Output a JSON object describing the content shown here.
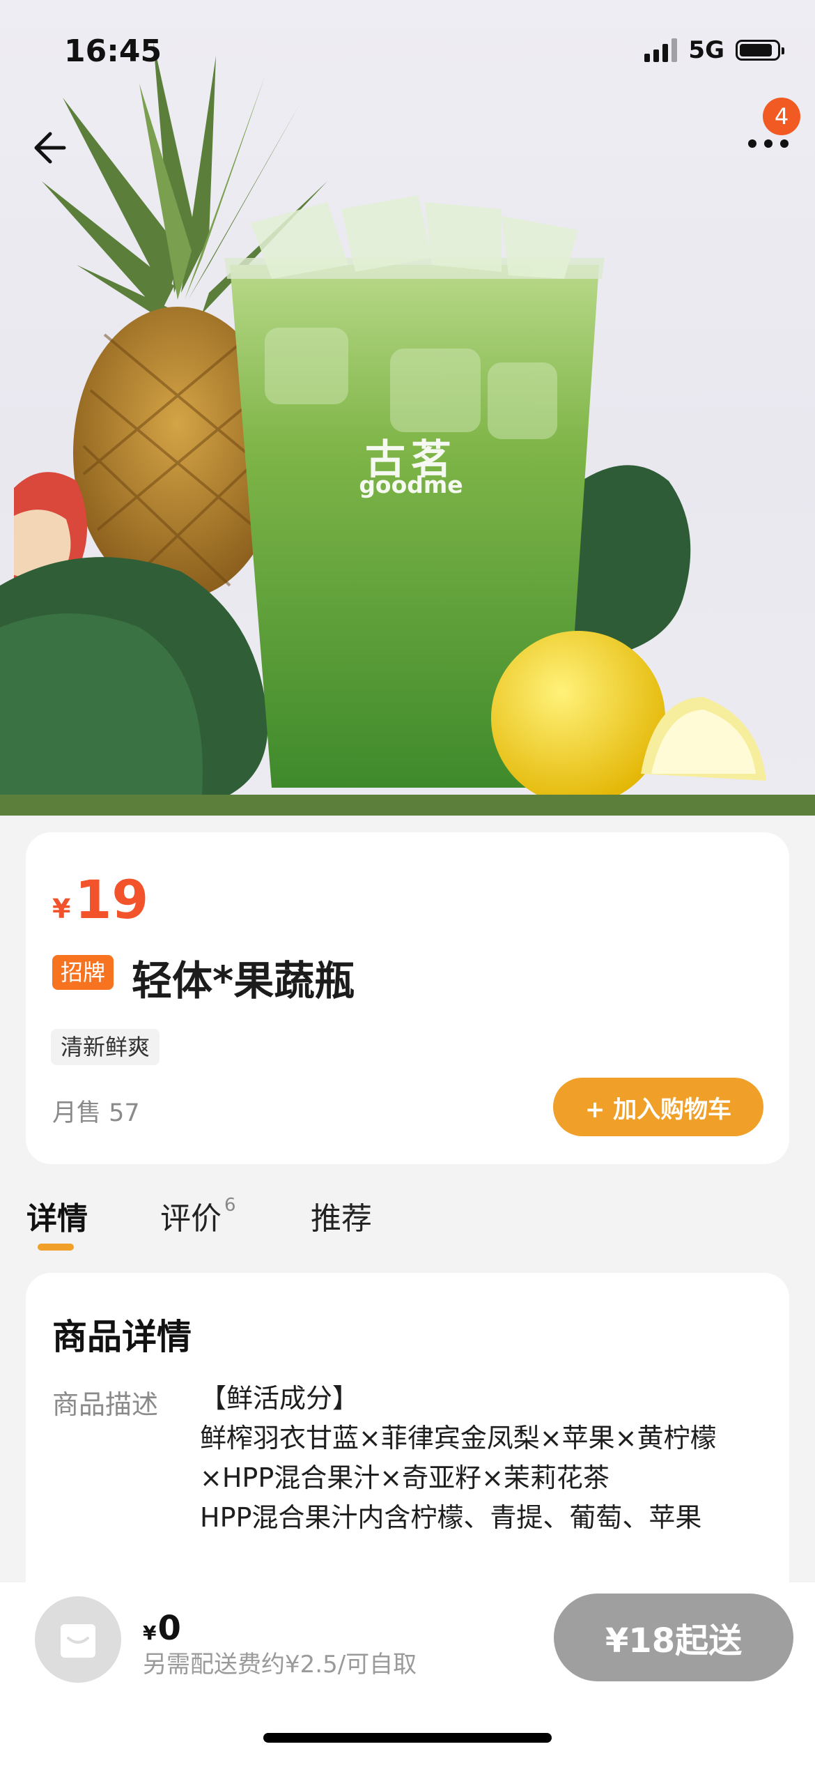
{
  "status_bar": {
    "time": "16:45",
    "network": "5G"
  },
  "nav": {
    "badge_count": "4"
  },
  "hero": {
    "cup_logo_cn": "古茗",
    "cup_logo_en": "goodme"
  },
  "product": {
    "currency": "¥",
    "price": "19",
    "tag": "招牌",
    "name": "轻体*果蔬瓶",
    "flavor_tag": "清新鲜爽",
    "monthly_sales": "月售 57",
    "add_to_cart": "+ 加入购物车"
  },
  "tabs": [
    {
      "label": "详情"
    },
    {
      "label": "评价",
      "count": "6"
    },
    {
      "label": "推荐"
    }
  ],
  "detail": {
    "heading": "商品详情",
    "label": "商品描述",
    "lines": [
      "【鲜活成分】",
      "鲜榨羽衣甘蓝×菲律宾金凤梨×苹果×黄柠檬",
      "×HPP混合果汁×奇亚籽×茉莉花茶",
      "HPP混合果汁内含柠檬、青提、葡萄、苹果"
    ]
  },
  "bottom_bar": {
    "currency": "¥",
    "total": "0",
    "delivery_note": "另需配送费约¥2.5/可自取",
    "checkout": "¥18起送"
  },
  "colors": {
    "price": "#f2532a",
    "accent": "#f0a028",
    "tag": "#f7731f",
    "badge": "#f25a23"
  }
}
